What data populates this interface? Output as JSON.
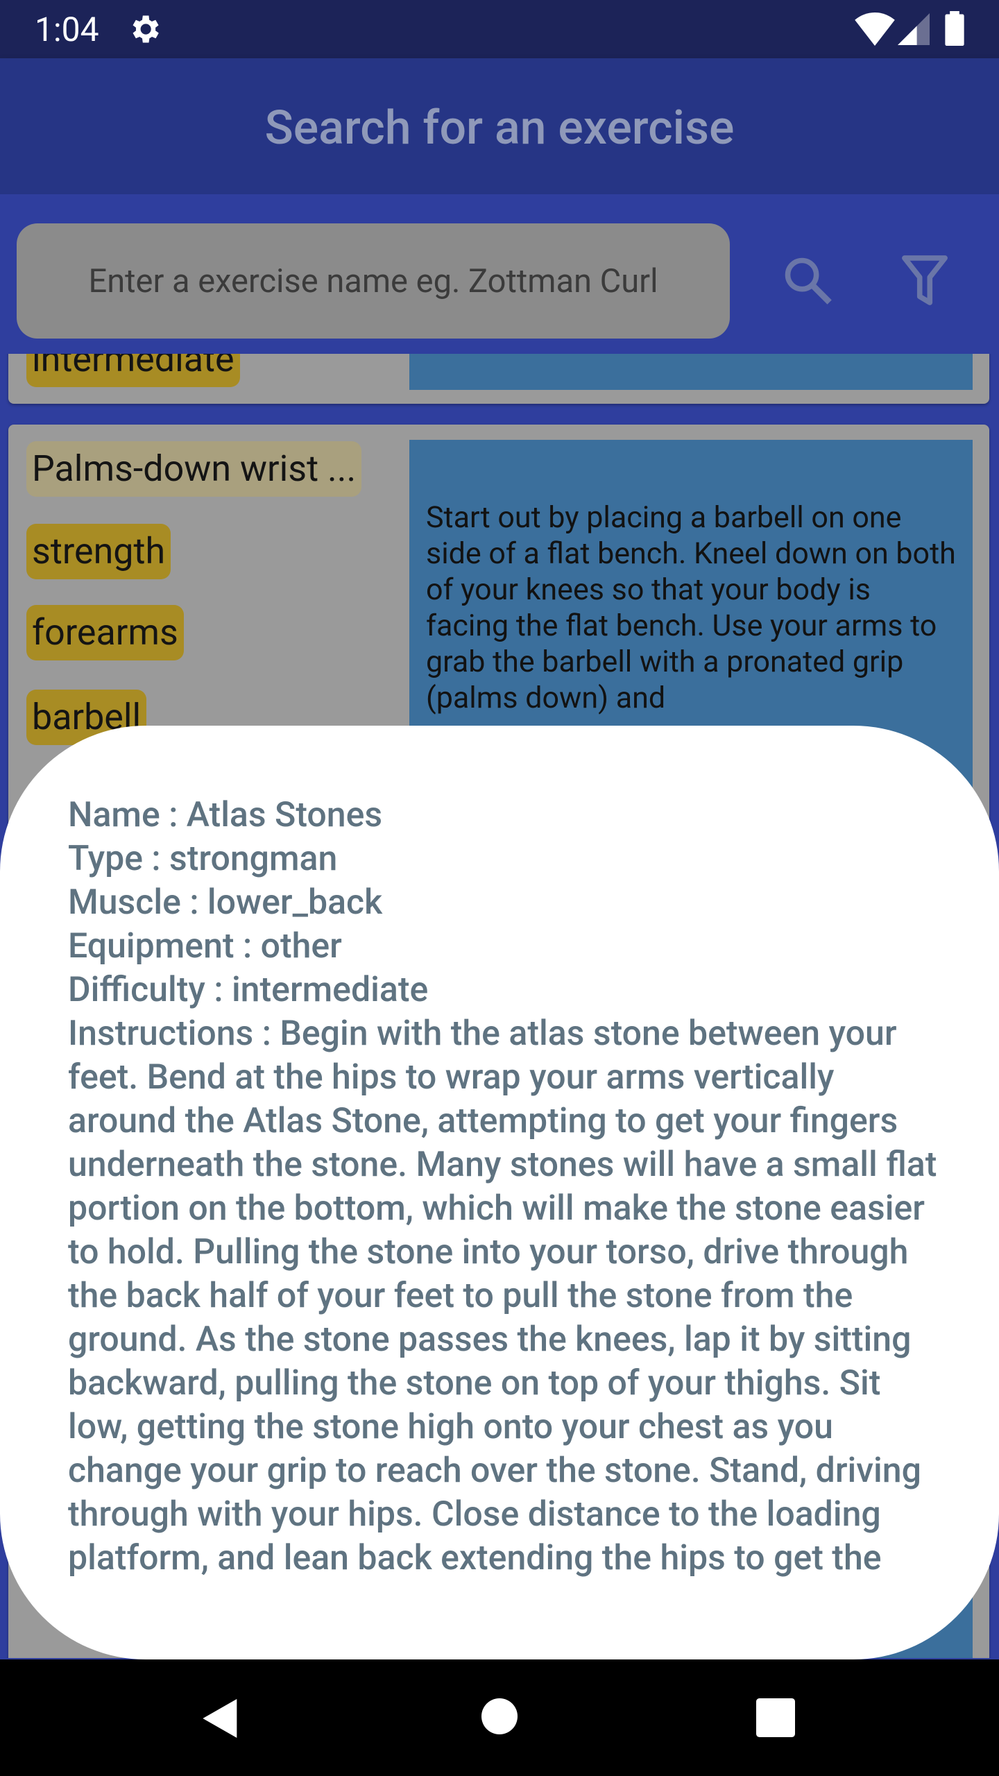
{
  "status": {
    "time": "1:04"
  },
  "app_bar": {
    "title": "Search for an exercise"
  },
  "search": {
    "placeholder": "Enter a exercise name eg. Zottman Curl"
  },
  "list": {
    "card_top": {
      "chip": "intermediate"
    },
    "card_main": {
      "name": "Palms-down wrist ...",
      "type": "strength",
      "muscle": "forearms",
      "equipment": "barbell",
      "description": "Start out by placing a barbell on one side of a flat bench. Kneel down on both of your knees so that your body is facing the flat bench. Use your arms to grab the barbell with a pronated grip (palms down) and"
    }
  },
  "dialog": {
    "name": "Name : Atlas Stones",
    "type": "Type : strongman",
    "muscle": "Muscle : lower_back",
    "equipment": "Equipment : other",
    "difficulty": "Difficulty : intermediate",
    "instructions": "Instructions : Begin with the atlas stone between your feet. Bend at the hips to wrap your arms vertically around the Atlas Stone, attempting to get your fingers underneath the stone. Many stones will have a small flat portion on the bottom, which will make the stone easier to hold. Pulling the stone into your torso, drive through the back half of your feet to pull the stone from the ground. As the stone passes the knees, lap it by sitting backward, pulling the stone on top of your thighs. Sit low, getting the stone high onto your chest as you change your grip to reach over the stone. Stand, driving through with your hips. Close distance to the loading platform, and lean back extending the hips to get the stone"
  },
  "colors": {
    "status_bar": "#1c2358",
    "app_bar": "#263585",
    "chip": "#a88c24",
    "card_description": "#3b6f9c",
    "dialog_text": "#5f7381"
  },
  "icons": {
    "status": [
      "gear-icon",
      "wifi-icon",
      "signal-icon",
      "battery-icon"
    ],
    "toolbar": [
      "search-icon",
      "filter-icon"
    ],
    "nav": [
      "back-icon",
      "home-icon",
      "recents-icon"
    ]
  }
}
